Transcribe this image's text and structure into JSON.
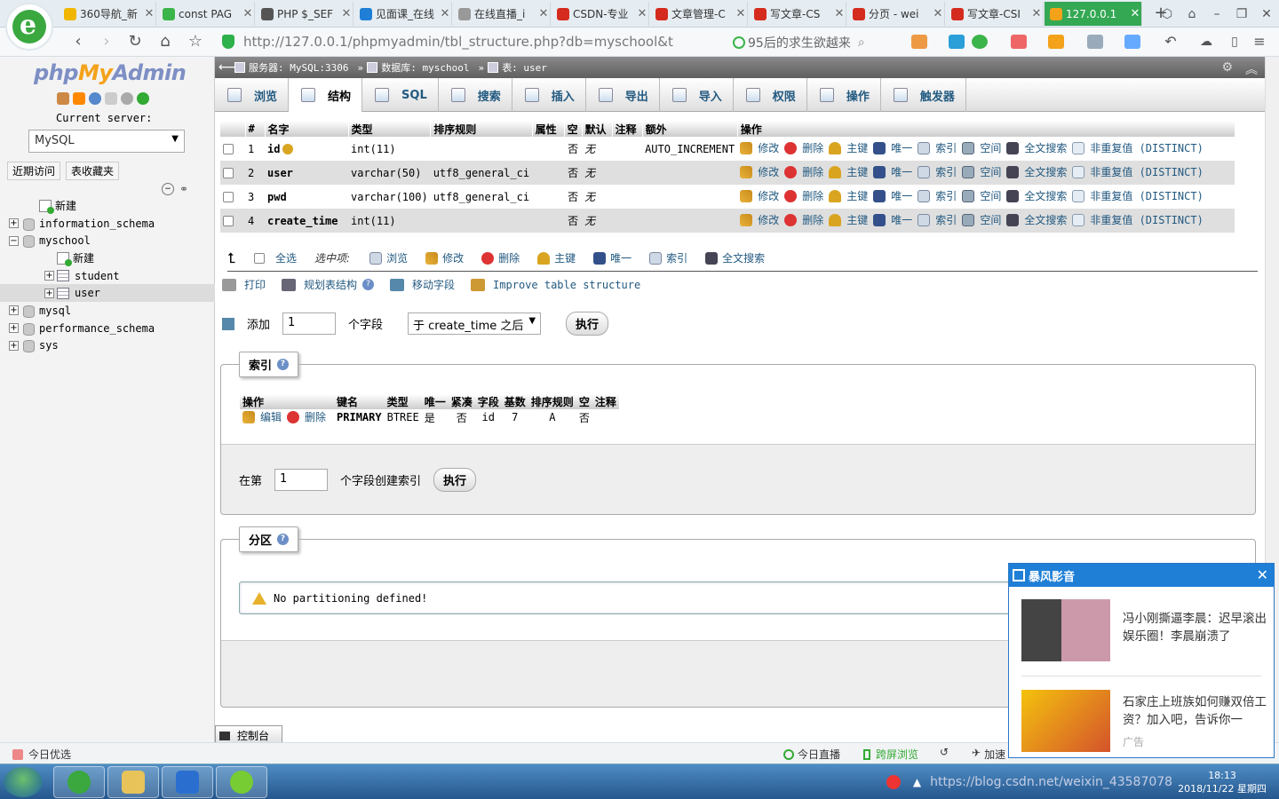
{
  "browser": {
    "tabs": [
      {
        "label": "360导航_新",
        "icon_color": "#f1b700",
        "icon": "360-icon"
      },
      {
        "label": "const PAG",
        "icon_color": "#3bb54a",
        "icon": "search-icon"
      },
      {
        "label": "PHP $_SEF",
        "icon_color": "#555555",
        "icon": "php-icon"
      },
      {
        "label": "见面课_在线",
        "icon_color": "#1f7fd6",
        "icon": "video-icon"
      },
      {
        "label": "在线直播_i",
        "icon_color": "#999999",
        "icon": "page-icon"
      },
      {
        "label": "CSDN-专业",
        "icon_color": "#d52b1e",
        "icon": "csdn-icon"
      },
      {
        "label": "文章管理-C",
        "icon_color": "#d52b1e",
        "icon": "csdn-icon"
      },
      {
        "label": "写文章-CS",
        "icon_color": "#d52b1e",
        "icon": "csdn-icon"
      },
      {
        "label": "分页 - wei",
        "icon_color": "#d52b1e",
        "icon": "csdn-icon"
      },
      {
        "label": "写文章-CSI",
        "icon_color": "#d52b1e",
        "icon": "csdn-icon"
      },
      {
        "label": "127.0.0.1",
        "icon_color": "#f4a21a",
        "icon": "pma-icon",
        "active": true
      }
    ],
    "address": "http://127.0.0.1/phpmyadmin/tbl_structure.php?db=myschool&t",
    "search_text": "95后的求生欲越来"
  },
  "sidebar": {
    "logo_php": "php",
    "logo_my": "My",
    "logo_admin": "Admin",
    "current_server_label": "Current server:",
    "server_value": "MySQL",
    "recent_label": "近期访问",
    "favorites_label": "表收藏夹",
    "tree": [
      {
        "label": "新建",
        "level": 1,
        "kind": "new"
      },
      {
        "label": "information_schema",
        "level": 0,
        "kind": "db",
        "exp": "+"
      },
      {
        "label": "myschool",
        "level": 0,
        "kind": "db",
        "exp": "−"
      },
      {
        "label": "新建",
        "level": 2,
        "kind": "new"
      },
      {
        "label": "student",
        "level": 2,
        "kind": "table",
        "exp": "+"
      },
      {
        "label": "user",
        "level": 2,
        "kind": "table",
        "exp": "+",
        "selected": true
      },
      {
        "label": "mysql",
        "level": 0,
        "kind": "db",
        "exp": "+"
      },
      {
        "label": "performance_schema",
        "level": 0,
        "kind": "db",
        "exp": "+"
      },
      {
        "label": "sys",
        "level": 0,
        "kind": "db",
        "exp": "+"
      }
    ]
  },
  "breadcrumb": {
    "server": "服务器: MySQL:3306",
    "database": "数据库: myschool",
    "table": "表: user"
  },
  "menu": [
    {
      "label": "浏览",
      "icon": "browse-icon"
    },
    {
      "label": "结构",
      "icon": "structure-icon",
      "active": true
    },
    {
      "label": "SQL",
      "icon": "sql-icon"
    },
    {
      "label": "搜索",
      "icon": "search-icon"
    },
    {
      "label": "插入",
      "icon": "insert-icon"
    },
    {
      "label": "导出",
      "icon": "export-icon"
    },
    {
      "label": "导入",
      "icon": "import-icon"
    },
    {
      "label": "权限",
      "icon": "privileges-icon"
    },
    {
      "label": "操作",
      "icon": "operations-icon"
    },
    {
      "label": "触发器",
      "icon": "triggers-icon"
    }
  ],
  "structure": {
    "headers": [
      "#",
      "名字",
      "类型",
      "排序规则",
      "属性",
      "空",
      "默认",
      "注释",
      "额外",
      "操作"
    ],
    "rows": [
      {
        "num": "1",
        "name": "id",
        "type": "int(11)",
        "collation": "",
        "attr": "",
        "null": "否",
        "default": "无",
        "comment": "",
        "extra": "AUTO_INCREMENT",
        "primary": true
      },
      {
        "num": "2",
        "name": "user",
        "type": "varchar(50)",
        "collation": "utf8_general_ci",
        "attr": "",
        "null": "否",
        "default": "无",
        "comment": "",
        "extra": ""
      },
      {
        "num": "3",
        "name": "pwd",
        "type": "varchar(100)",
        "collation": "utf8_general_ci",
        "attr": "",
        "null": "否",
        "default": "无",
        "comment": "",
        "extra": ""
      },
      {
        "num": "4",
        "name": "create_time",
        "type": "int(11)",
        "collation": "",
        "attr": "",
        "null": "否",
        "default": "无",
        "comment": "",
        "extra": ""
      }
    ],
    "row_actions": {
      "edit": "修改",
      "drop": "删除",
      "primary": "主键",
      "unique": "唯一",
      "index": "索引",
      "spatial": "空间",
      "fulltext": "全文搜索",
      "distinct": "非重复值 (DISTINCT)"
    }
  },
  "bulk": {
    "select_all": "全选",
    "with_selected": "选中项:",
    "browse": "浏览",
    "edit": "修改",
    "drop": "删除",
    "primary": "主键",
    "unique": "唯一",
    "index": "索引",
    "fulltext": "全文搜索"
  },
  "tools": {
    "print": "打印",
    "propose": "规划表结构",
    "move": "移动字段",
    "improve": "Improve table structure"
  },
  "add_field": {
    "label": "添加",
    "count": "1",
    "suffix": "个字段",
    "position": "于 create_time 之后",
    "go": "执行"
  },
  "indexes": {
    "legend": "索引",
    "headers": [
      "操作",
      "键名",
      "类型",
      "唯一",
      "紧凑",
      "字段",
      "基数",
      "排序规则",
      "空",
      "注释"
    ],
    "row": {
      "edit": "编辑",
      "drop": "删除",
      "keyname": "PRIMARY",
      "type": "BTREE",
      "unique": "是",
      "packed": "否",
      "column": "id",
      "cardinality": "7",
      "collation": "A",
      "null": "否",
      "comment": ""
    },
    "create_prefix": "在第",
    "create_count": "1",
    "create_suffix": "个字段创建索引",
    "go": "执行"
  },
  "partitions": {
    "legend": "分区",
    "message": "No partitioning defined!"
  },
  "console_label": "控制台",
  "ad": {
    "brand": "暴风影音",
    "items": [
      {
        "text": "冯小刚撕逼李晨：迟早滚出娱乐圈！李晨崩溃了"
      },
      {
        "text": "石家庄上班族如何赚双倍工资？加入吧，告诉你一",
        "tag": "广告"
      }
    ]
  },
  "statusbar": {
    "left": "今日优选",
    "live": "今日直播",
    "cross": "跨屏浏览",
    "speed": "加速"
  },
  "taskbar": {
    "url_overlay": "https://blog.csdn.net/weixin_43587078",
    "time": "18:13",
    "date": "2018/11/22 星期四"
  }
}
